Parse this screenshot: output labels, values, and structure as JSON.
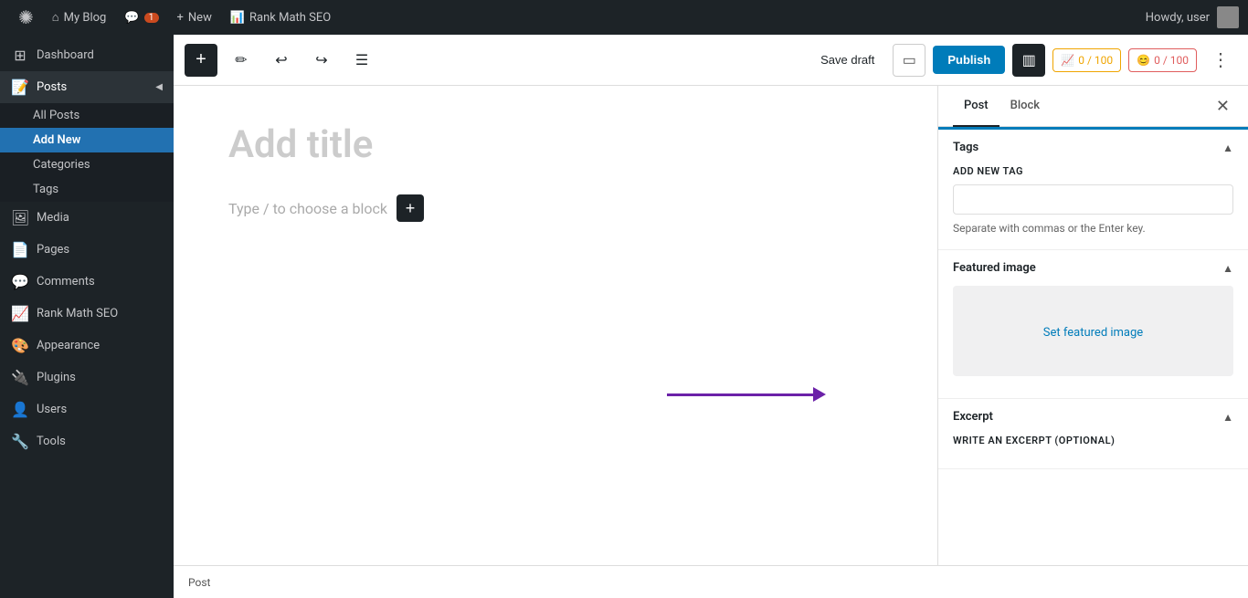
{
  "adminbar": {
    "logo": "✺",
    "site_name": "My Blog",
    "comments_label": "Comments",
    "comments_count": "1",
    "new_label": "New",
    "rank_math_label": "Rank Math SEO",
    "howdy": "Howdy, user"
  },
  "sidebar": {
    "dashboard": "Dashboard",
    "posts": "Posts",
    "all_posts": "All Posts",
    "add_new": "Add New",
    "categories": "Categories",
    "tags": "Tags",
    "media": "Media",
    "pages": "Pages",
    "comments": "Comments",
    "rank_math": "Rank Math SEO",
    "appearance": "Appearance",
    "plugins": "Plugins",
    "users": "Users",
    "tools": "Tools"
  },
  "toolbar": {
    "add_label": "+",
    "save_draft": "Save draft",
    "publish_label": "Publish",
    "rank_score1": "0 / 100",
    "rank_score2": "0 / 100"
  },
  "editor": {
    "title_placeholder": "Add title",
    "block_placeholder": "Type / to choose a block"
  },
  "panel": {
    "post_tab": "Post",
    "block_tab": "Block",
    "tags_section_title": "Tags",
    "add_new_tag_label": "ADD NEW TAG",
    "tag_input_placeholder": "",
    "tag_hint": "Separate with commas or the Enter key.",
    "featured_image_title": "Featured image",
    "set_featured_image": "Set featured image",
    "excerpt_title": "Excerpt",
    "write_excerpt_label": "WRITE AN EXCERPT (OPTIONAL)"
  },
  "bottom_bar": {
    "label": "Post"
  }
}
